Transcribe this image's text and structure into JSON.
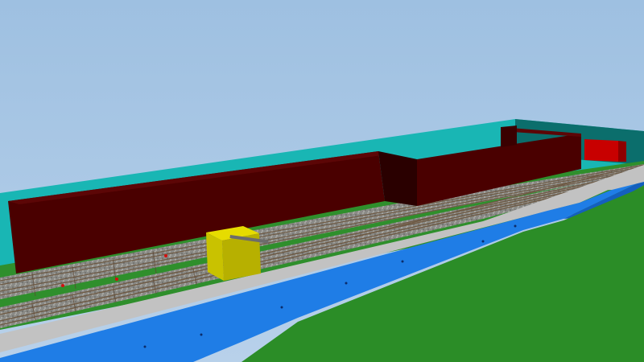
{
  "scene": {
    "kind": "3d-model-railway-layout-view",
    "colors": {
      "sky": "#a9c6e4",
      "sky_top": "#9ec0e1",
      "backdrop_wall": "#19b6b4",
      "backdrop_wall_dark": "#0b6e6c",
      "building_front": "#4a0000",
      "building_top": "#5c0606",
      "building_side": "#2a0000",
      "grass": "#2f8f2c",
      "ballast": "#8c8c88",
      "rail": "#6e5a44",
      "sleeper": "#5a4634",
      "platform_edge": "#c2c2c2",
      "water": "#1f7de6",
      "water_dark": "#145fbe",
      "shore": "#2b8d27",
      "block_yellow": "#e6dc00",
      "block_yellow_side": "#b7b000",
      "small_red_building": "#c80000",
      "signal_red": "#d21010"
    },
    "objects": [
      {
        "name": "backdrop-wall",
        "icon": "wall"
      },
      {
        "name": "long-warehouse",
        "icon": "building"
      },
      {
        "name": "rear-warehouse",
        "icon": "building"
      },
      {
        "name": "yellow-control-box",
        "icon": "box"
      },
      {
        "name": "red-shed",
        "icon": "building"
      },
      {
        "name": "river",
        "icon": "water"
      }
    ]
  }
}
